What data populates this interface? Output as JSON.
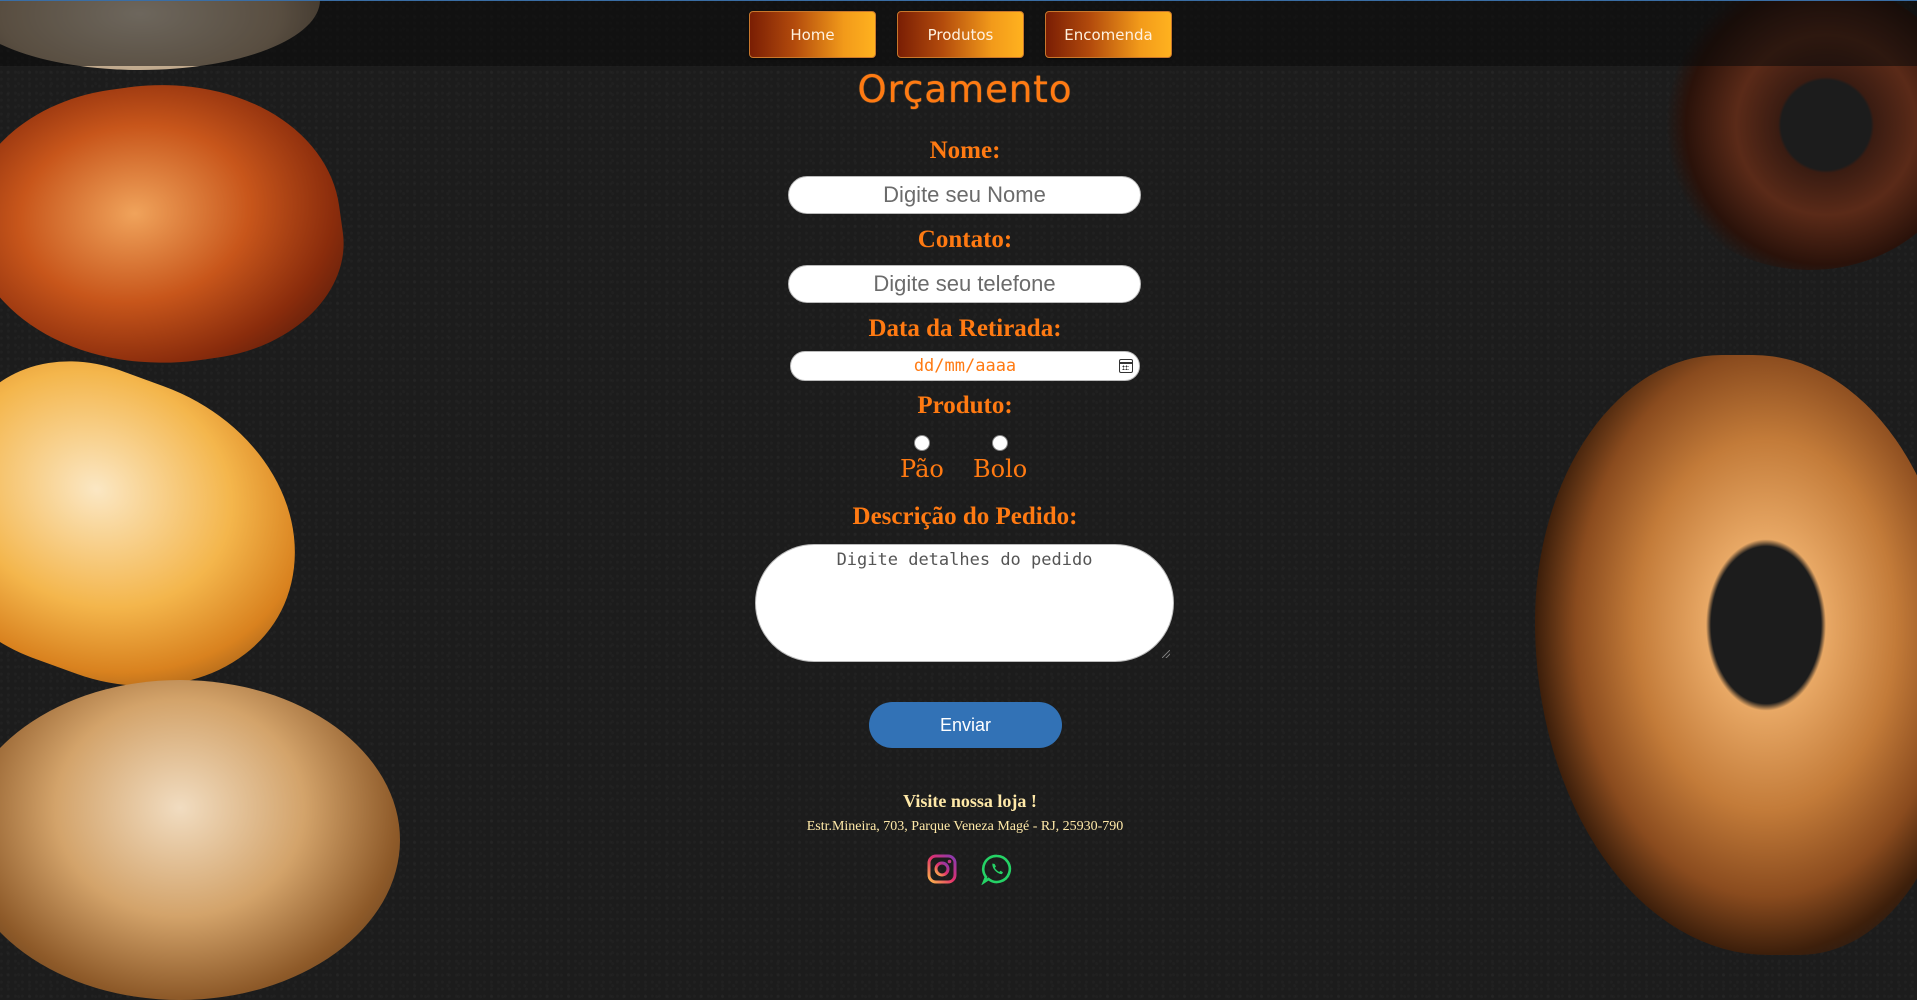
{
  "nav": {
    "items": [
      {
        "label": "Home"
      },
      {
        "label": "Produtos"
      },
      {
        "label": "Encomenda"
      }
    ]
  },
  "form": {
    "title": "Orçamento",
    "name_label": "Nome:",
    "name_placeholder": "Digite seu Nome",
    "contact_label": "Contato:",
    "contact_placeholder": "Digite seu telefone",
    "date_label": "Data da Retirada:",
    "date_placeholder": "dd/mm/aaaa",
    "product_label": "Produto:",
    "product_options": [
      {
        "label": "Pão",
        "checked": false
      },
      {
        "label": "Bolo",
        "checked": false
      }
    ],
    "description_label": "Descrição do Pedido:",
    "description_placeholder": "Digite detalhes do pedido",
    "submit_label": "Enviar"
  },
  "footer": {
    "visit_text": "Visite nossa loja !",
    "address": "Estr.Mineira, 703, Parque Veneza Magé - RJ, 25930-790",
    "social": [
      {
        "icon": "instagram-icon",
        "color": "#e1306c"
      },
      {
        "icon": "whatsapp-icon",
        "color": "#25d366"
      }
    ]
  },
  "colors": {
    "accent": "#ff7a12",
    "submit": "#3272b6",
    "footer_text": "#ffe9a8",
    "background": "#1c1c1c"
  }
}
